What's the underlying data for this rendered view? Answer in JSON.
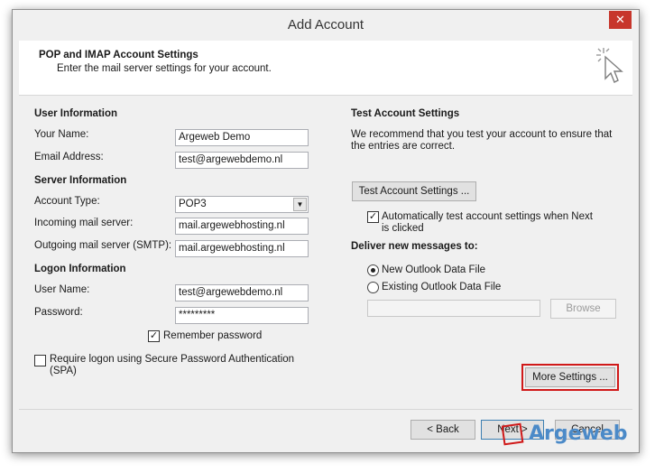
{
  "window": {
    "title": "Add Account",
    "close_glyph": "✕"
  },
  "header": {
    "title": "POP and IMAP Account Settings",
    "subtitle": "Enter the mail server settings for your account."
  },
  "left": {
    "user_info": {
      "heading": "User Information",
      "name_label": "Your Name:",
      "name_value": "Argeweb Demo",
      "email_label": "Email Address:",
      "email_value": "test@argewebdemo.nl"
    },
    "server_info": {
      "heading": "Server Information",
      "type_label": "Account Type:",
      "type_value": "POP3",
      "incoming_label": "Incoming mail server:",
      "incoming_value": "mail.argewebhosting.nl",
      "outgoing_label": "Outgoing mail server (SMTP):",
      "outgoing_value": "mail.argewebhosting.nl"
    },
    "logon_info": {
      "heading": "Logon Information",
      "username_label": "User Name:",
      "username_value": "test@argewebdemo.nl",
      "password_label": "Password:",
      "password_value": "*********",
      "remember_label": "Remember password",
      "remember_checked": true,
      "spa_label_1": "Require logon using Secure Password Authentication",
      "spa_label_2": "(SPA)",
      "spa_checked": false
    }
  },
  "right": {
    "heading": "Test Account Settings",
    "desc_1": "We recommend that you test your account to ensure that",
    "desc_2": "the entries are correct.",
    "test_button": "Test Account Settings ...",
    "auto_test_1": "Automatically test account settings when Next",
    "auto_test_2": "is clicked",
    "auto_test_checked": true,
    "deliver_heading": "Deliver new messages to:",
    "new_pst": "New Outlook Data File",
    "existing_pst": "Existing Outlook Data File",
    "browse": "Browse",
    "more_settings": "More Settings ..."
  },
  "footer": {
    "back": "< Back",
    "next": "Next >",
    "cancel": "Cancel"
  },
  "watermark": "Argeweb",
  "colors": {
    "highlight": "#d01919",
    "close": "#c7362c",
    "watermark": "#4b8ac8"
  }
}
